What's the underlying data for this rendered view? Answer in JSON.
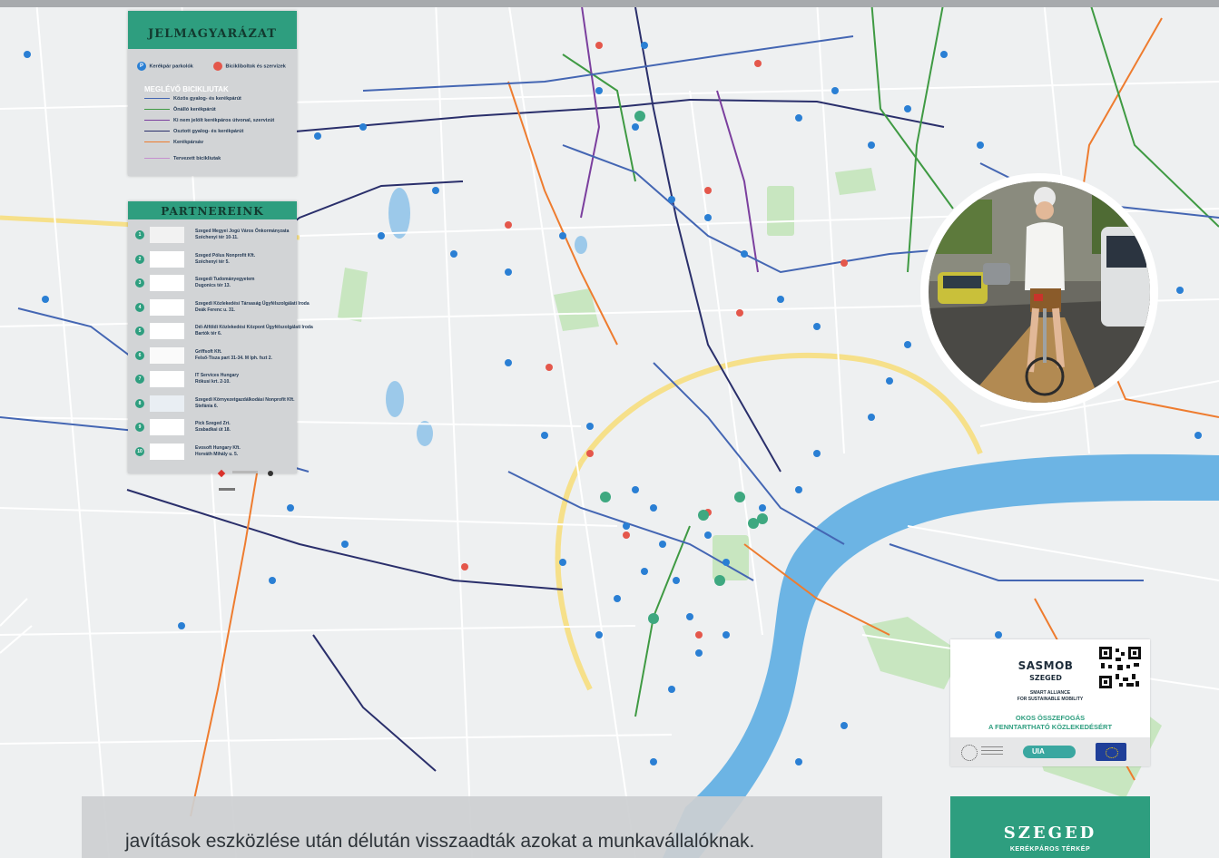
{
  "legend": {
    "title": "JELMAGYARÁZAT",
    "bike_parking": "Kerékpár parkolók",
    "bike_shops": "Bicikliboltok és szervizek",
    "existing_title": "MEGLÉVŐ BICIKLIUTAK",
    "items": [
      {
        "label": "Közös gyalog- és kerékpárút",
        "color": "#4466b3"
      },
      {
        "label": "Önálló kerékpárút",
        "color": "#3f9a43"
      },
      {
        "label": "Ki nem jelölt kerékpáros útvonal, szervizút",
        "color": "#7b3f9e"
      },
      {
        "label": "Osztott gyalog- és kerékpárút",
        "color": "#2a2f6b"
      },
      {
        "label": "Kerékpársáv",
        "color": "#ee7c2f"
      }
    ],
    "planned": {
      "label": "Tervezett bicikliutak",
      "color": "#c58fcf"
    }
  },
  "partners": {
    "title": "PARTNEREINK",
    "items": [
      {
        "num": "1",
        "line1": "Szeged Megyei Jogú Város Önkormányzata",
        "line2": "Széchenyi tér 10-11."
      },
      {
        "num": "2",
        "line1": "Szeged Pólus Nonprofit Kft.",
        "line2": "Széchenyi tér 5."
      },
      {
        "num": "3",
        "line1": "Szegedi Tudományegyetem",
        "line2": "Dugonics tér 13."
      },
      {
        "num": "4",
        "line1": "Szegedi Közlekedési Társaság Ügyfélszolgálati Iroda",
        "line2": "Deák Ferenc u. 31."
      },
      {
        "num": "5",
        "line1": "Dél-Alföldi Közlekedési Központ Ügyfélszolgálati Iroda",
        "line2": "Bartók tér 6."
      },
      {
        "num": "6",
        "line1": "Griffsoft Kft.",
        "line2": "Felső-Tisza part 31-34. M lph. fszt 2."
      },
      {
        "num": "7",
        "line1": "IT Services Hungary",
        "line2": "Rókusi krt. 2-10."
      },
      {
        "num": "8",
        "line1": "Szegedi Környezetgazdálkodási Nonprofit Kft.",
        "line2": "Stefánia 6."
      },
      {
        "num": "9",
        "line1": "Pick Szeged Zrt.",
        "line2": "Szabadkai út 18."
      },
      {
        "num": "10",
        "line1": "Evosoft Hungary Kft.",
        "line2": "Horváth Mihály u. 5."
      }
    ]
  },
  "sasmob": {
    "name": "SASMOB",
    "city": "SZEGED",
    "tagline1": "SMART ALLIANCE",
    "tagline2": "FOR SUSTAINABLE MOBILITY",
    "slogan1": "OKOS ÖSSZEFOGÁS",
    "slogan2": "A FENNTARTHATÓ KÖZLEKEDÉSÉRT",
    "uia": "UIA"
  },
  "footer": {
    "title": "SZEGED",
    "subtitle": "KERÉKPÁROS TÉRKÉP"
  },
  "caption": "javítások eszközlése után délután visszaadták azokat a munkavállalóknak.",
  "colors": {
    "accent": "#2e9e7f",
    "river": "#6cb4e4",
    "park": "#c6e5bf"
  }
}
